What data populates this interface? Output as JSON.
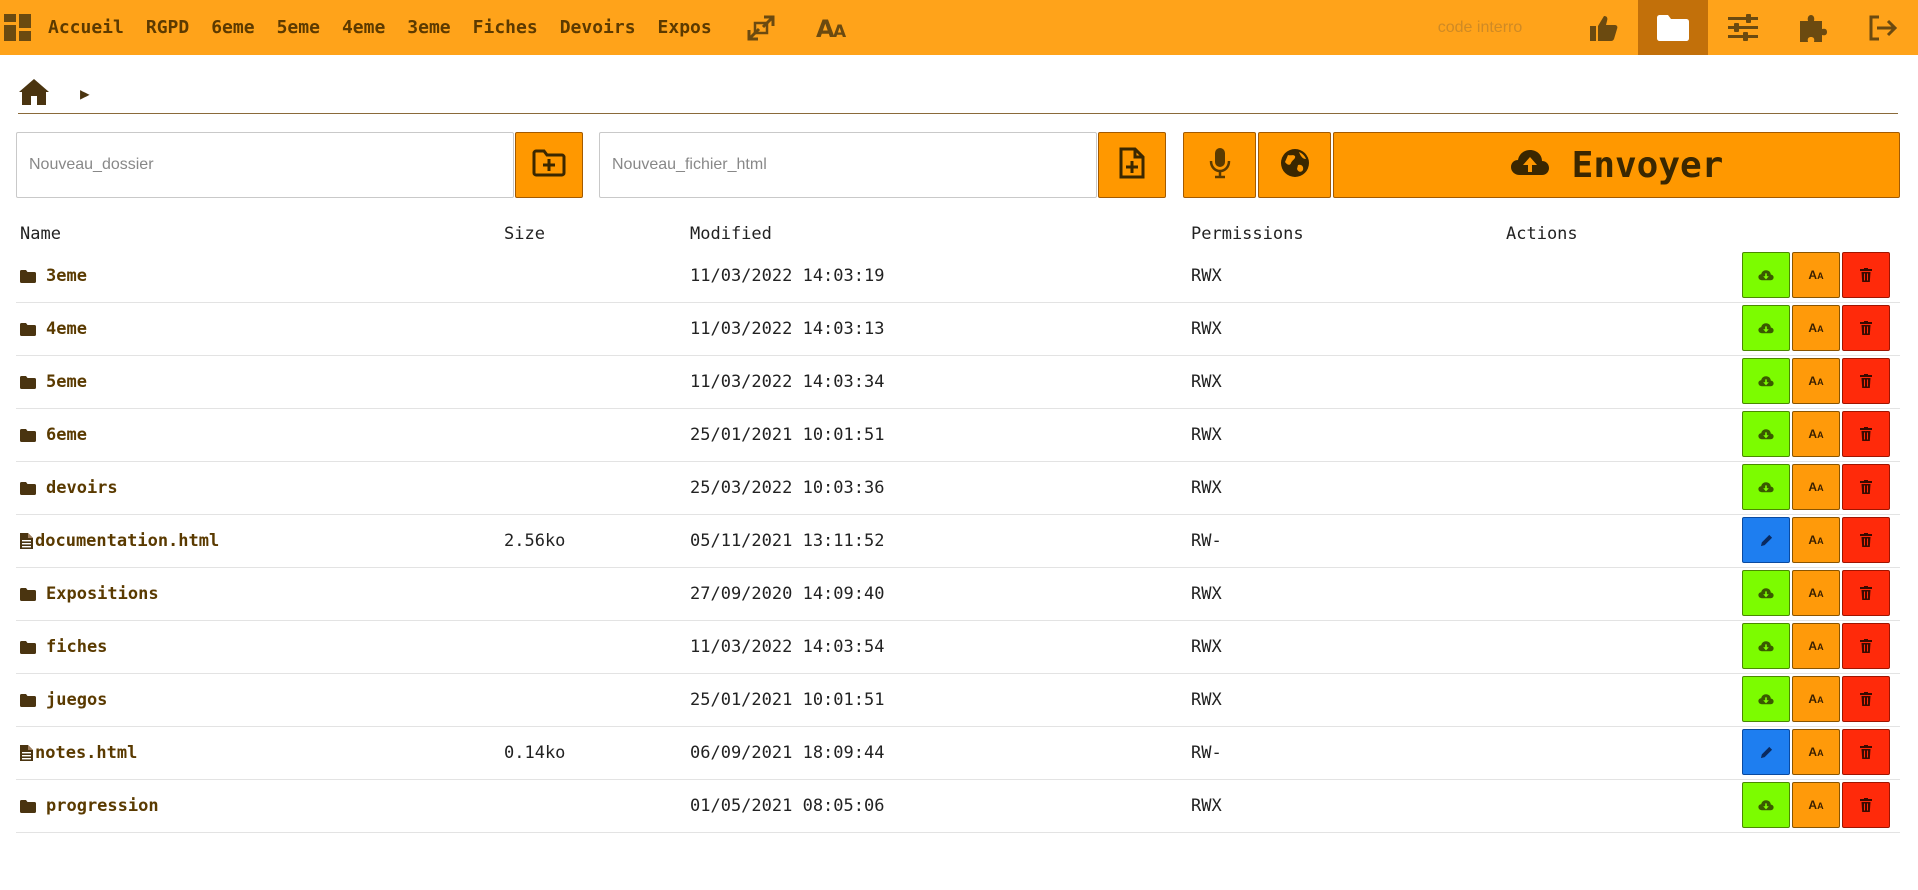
{
  "nav": {
    "items": [
      "Accueil",
      "RGPD",
      "6eme",
      "5eme",
      "4eme",
      "3eme",
      "Fiches",
      "Devoirs",
      "Expos"
    ],
    "code_placeholder": "code interro"
  },
  "breadcrumb": {
    "separator": "▶"
  },
  "toolbar": {
    "folder_placeholder": "Nouveau_dossier",
    "file_placeholder": "Nouveau_fichier_html",
    "send_label": "Envoyer"
  },
  "table": {
    "headers": {
      "name": "Name",
      "size": "Size",
      "modified": "Modified",
      "permissions": "Permissions",
      "actions": "Actions"
    },
    "rows": [
      {
        "type": "folder",
        "name": "3eme",
        "size": "",
        "modified": "11/03/2022 14:03:19",
        "perm": "RWX"
      },
      {
        "type": "folder",
        "name": "4eme",
        "size": "",
        "modified": "11/03/2022 14:03:13",
        "perm": "RWX"
      },
      {
        "type": "folder",
        "name": "5eme",
        "size": "",
        "modified": "11/03/2022 14:03:34",
        "perm": "RWX"
      },
      {
        "type": "folder",
        "name": "6eme",
        "size": "",
        "modified": "25/01/2021 10:01:51",
        "perm": "RWX"
      },
      {
        "type": "folder",
        "name": "devoirs",
        "size": "",
        "modified": "25/03/2022 10:03:36",
        "perm": "RWX"
      },
      {
        "type": "file",
        "name": "documentation.html",
        "size": "2.56ko",
        "modified": "05/11/2021 13:11:52",
        "perm": "RW-"
      },
      {
        "type": "folder",
        "name": "Expositions",
        "size": "",
        "modified": "27/09/2020 14:09:40",
        "perm": "RWX"
      },
      {
        "type": "folder",
        "name": "fiches",
        "size": "",
        "modified": "11/03/2022 14:03:54",
        "perm": "RWX"
      },
      {
        "type": "folder",
        "name": "juegos",
        "size": "",
        "modified": "25/01/2021 10:01:51",
        "perm": "RWX"
      },
      {
        "type": "file",
        "name": "notes.html",
        "size": "0.14ko",
        "modified": "06/09/2021 18:09:44",
        "perm": "RW-"
      },
      {
        "type": "folder",
        "name": "progression",
        "size": "",
        "modified": "01/05/2021 08:05:06",
        "perm": "RWX"
      }
    ]
  },
  "colors": {
    "accent": "#ffa31a",
    "active": "#c2700a",
    "green": "#7cfc00",
    "blue": "#1e7ef0",
    "red": "#ff2a0a"
  }
}
